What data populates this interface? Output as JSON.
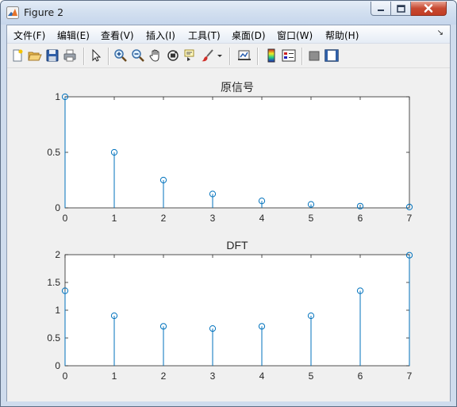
{
  "window": {
    "title": "Figure 2"
  },
  "menu": {
    "items": [
      {
        "label": "文件(F)"
      },
      {
        "label": "编辑(E)"
      },
      {
        "label": "查看(V)"
      },
      {
        "label": "插入(I)"
      },
      {
        "label": "工具(T)"
      },
      {
        "label": "桌面(D)"
      },
      {
        "label": "窗口(W)"
      },
      {
        "label": "帮助(H)"
      }
    ]
  },
  "toolbar": {
    "icons": [
      "new-figure-icon",
      "open-file-icon",
      "save-icon",
      "print-icon",
      "pointer-icon",
      "zoom-in-icon",
      "zoom-out-icon",
      "pan-hand-icon",
      "rotate-3d-icon",
      "data-cursor-icon",
      "brush-icon",
      "brush-dropdown-icon",
      "link-plot-icon",
      "colorbar-icon",
      "legend-icon",
      "hide-plot-tools-icon",
      "show-plot-tools-icon"
    ]
  },
  "colors": {
    "stem": "#0072bd",
    "axis": "#262626",
    "title": "#262626"
  },
  "chart_data": [
    {
      "type": "stem",
      "title": "原信号",
      "x": [
        0,
        1,
        2,
        3,
        4,
        5,
        6,
        7
      ],
      "y": [
        1,
        0.5,
        0.25,
        0.125,
        0.0625,
        0.03125,
        0.015625,
        0.0078125
      ],
      "xlim": [
        0,
        7
      ],
      "ylim": [
        0,
        1
      ],
      "xticks": [
        "0",
        "1",
        "2",
        "3",
        "4",
        "5",
        "6",
        "7"
      ],
      "yticks": [
        "0",
        "0.5",
        "1"
      ],
      "ytick_values": [
        0,
        0.5,
        1
      ]
    },
    {
      "type": "stem",
      "title": "DFT",
      "x": [
        0,
        1,
        2,
        3,
        4,
        5,
        6,
        7
      ],
      "y": [
        1.35,
        0.9,
        0.71,
        0.67,
        0.71,
        0.9,
        1.35,
        1.99
      ],
      "xlim": [
        0,
        7
      ],
      "ylim": [
        0,
        2
      ],
      "xticks": [
        "0",
        "1",
        "2",
        "3",
        "4",
        "5",
        "6",
        "7"
      ],
      "yticks": [
        "0",
        "0.5",
        "1",
        "1.5",
        "2"
      ],
      "ytick_values": [
        0,
        0.5,
        1,
        1.5,
        2
      ]
    }
  ]
}
